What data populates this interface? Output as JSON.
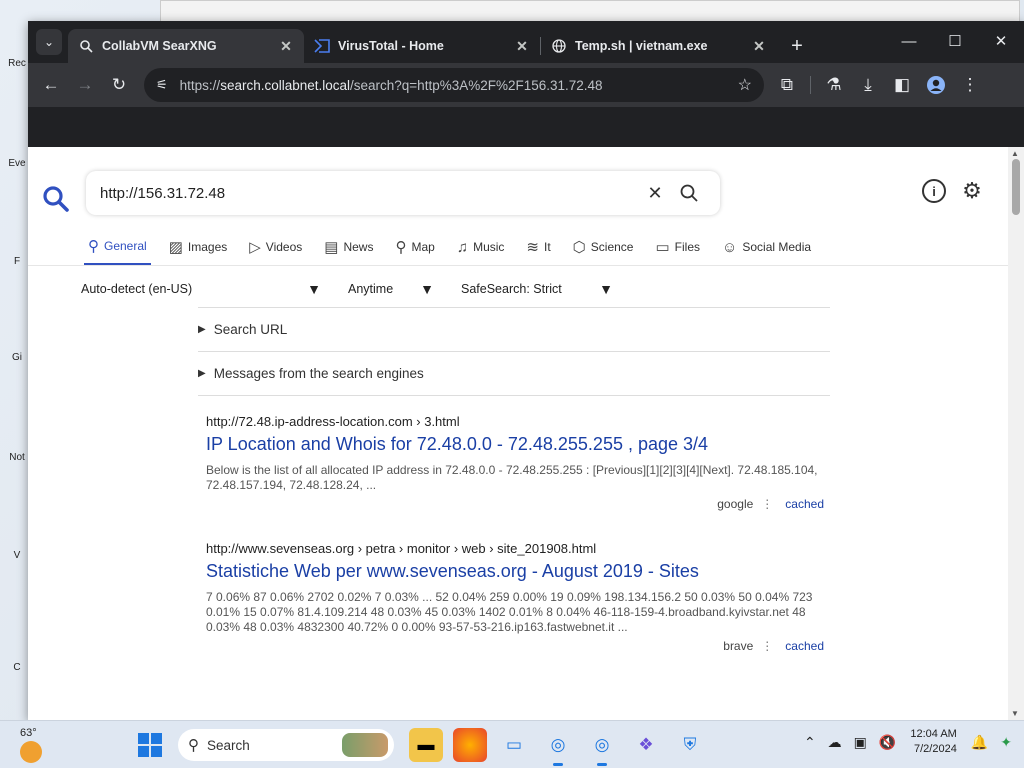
{
  "desktop": {
    "icon_labels": [
      "Rec",
      "Eve",
      "F",
      "Gi",
      "Not",
      "V",
      "C"
    ]
  },
  "tabs": [
    {
      "title": "CollabVM SearXNG",
      "icon": "searxng-icon",
      "active": true
    },
    {
      "title": "VirusTotal - Home",
      "icon": "virustotal-icon",
      "active": false
    },
    {
      "title": "Temp.sh | vietnam.exe",
      "icon": "globe-icon",
      "active": false
    }
  ],
  "address_bar": {
    "url_scheme": "https://",
    "url_host": "search.collabnet.local",
    "url_path": "/search?q=http%3A%2F%2F156.31.72.48"
  },
  "search": {
    "query": "http://156.31.72.48"
  },
  "categories": [
    {
      "label": "General",
      "icon": "search-icon",
      "active": true
    },
    {
      "label": "Images",
      "icon": "image-icon"
    },
    {
      "label": "Videos",
      "icon": "play-icon"
    },
    {
      "label": "News",
      "icon": "newspaper-icon"
    },
    {
      "label": "Map",
      "icon": "map-pin-icon"
    },
    {
      "label": "Music",
      "icon": "music-icon"
    },
    {
      "label": "It",
      "icon": "layers-icon"
    },
    {
      "label": "Science",
      "icon": "cube-icon"
    },
    {
      "label": "Files",
      "icon": "files-icon"
    },
    {
      "label": "Social Media",
      "icon": "people-icon"
    }
  ],
  "filters": {
    "language": "Auto-detect (en-US)",
    "time": "Anytime",
    "safesearch": "SafeSearch: Strict"
  },
  "details": {
    "search_url": "Search URL",
    "messages": "Messages from the search engines"
  },
  "results": [
    {
      "url": "http://72.48.ip-address-location.com  › 3.html",
      "title": "IP Location and Whois for 72.48.0.0 - 72.48.255.255 , page 3/4",
      "snippet": "Below is the list of all allocated IP address in 72.48.0.0 - 72.48.255.255 : [Previous][1][2][3][4][Next]. 72.48.185.104, 72.48.157.194, 72.48.128.24, ...",
      "engine": "google",
      "cached": "cached"
    },
    {
      "url": "http://www.sevenseas.org  › petra › monitor › web › site_201908.html",
      "title": "Statistiche Web per www.sevenseas.org - August 2019 - Sites",
      "snippet": "7 0.06% 87 0.06% 2702 0.02% 7 0.03% ... 52 0.04% 259 0.00% 19 0.09% 198.134.156.2 50 0.03% 50 0.04% 723 0.01% 15 0.07% 81.4.109.214 48 0.03% 45 0.03% 1402 0.01% 8 0.04% 46-118-159-4.broadband.kyivstar.net 48 0.03% 48 0.03% 4832300 40.72% 0 0.00% 93-57-53-216.ip163.fastwebnet.it ...",
      "engine": "brave",
      "cached": "cached"
    }
  ],
  "taskbar": {
    "weather": "63°",
    "search_label": "Search",
    "time": "12:04 AM",
    "date": "7/2/2024"
  }
}
